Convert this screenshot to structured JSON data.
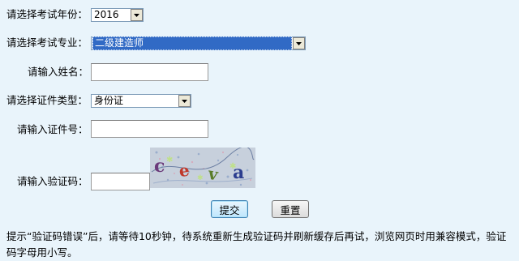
{
  "form": {
    "year": {
      "label": "请选择考试年份：",
      "selected": "2016"
    },
    "major": {
      "label": "请选择考试专业：",
      "selected": "二级建造师"
    },
    "name": {
      "label": "请输入姓名：",
      "value": ""
    },
    "id_type": {
      "label": "请选择证件类型：",
      "selected": "身份证"
    },
    "id_number": {
      "label": "请输入证件号：",
      "value": ""
    },
    "captcha": {
      "label": "请输入验证码：",
      "value": "",
      "image_chars": [
        "c",
        "e",
        "v",
        "a"
      ]
    },
    "submit_label": "提交",
    "reset_label": "重置"
  },
  "tip": "提示“验证码错误”后，请等待10秒钟，待系统重新生成验证码并刷新缓存后再试，浏览网页时用兼容模式，验证码字母用小写。"
}
